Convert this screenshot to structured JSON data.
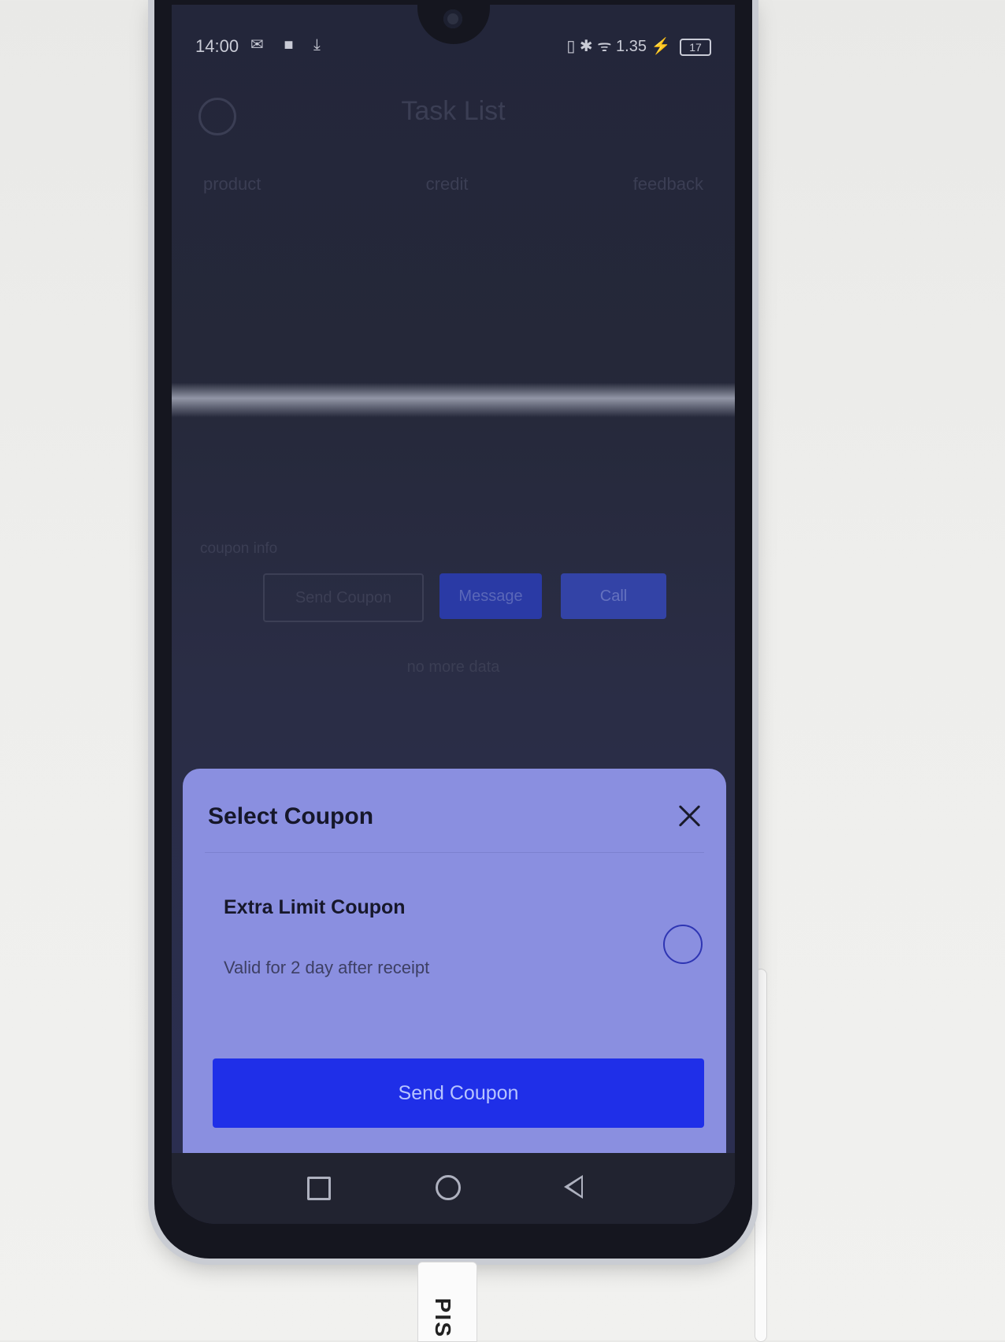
{
  "status_bar": {
    "time": "14:00",
    "left_icons": "✉ ■ ⤓",
    "right_icons": "▯ ✱ ᯤ 1.35 ⚡",
    "battery": "17"
  },
  "background": {
    "title": "Task List",
    "tabs": [
      "product",
      "credit",
      "feedback"
    ],
    "coupon_info": "coupon info",
    "buttons": {
      "send_coupon": "Send Coupon",
      "message": "Message",
      "call": "Call"
    },
    "no_more": "no more data"
  },
  "sheet": {
    "title": "Select Coupon",
    "coupon_name": "Extra Limit Coupon",
    "coupon_validity": "Valid for 2 day after receipt",
    "send_button": "Send Coupon"
  },
  "usb_label": "PIS",
  "colors": {
    "accent": "#1f2fe8",
    "sheet_bg": "#8a8fe0"
  },
  "icons": {
    "close": "close-icon",
    "radio": "radio-unselected-icon",
    "nav": [
      "square-recent-icon",
      "circle-home-icon",
      "triangle-back-icon"
    ]
  }
}
